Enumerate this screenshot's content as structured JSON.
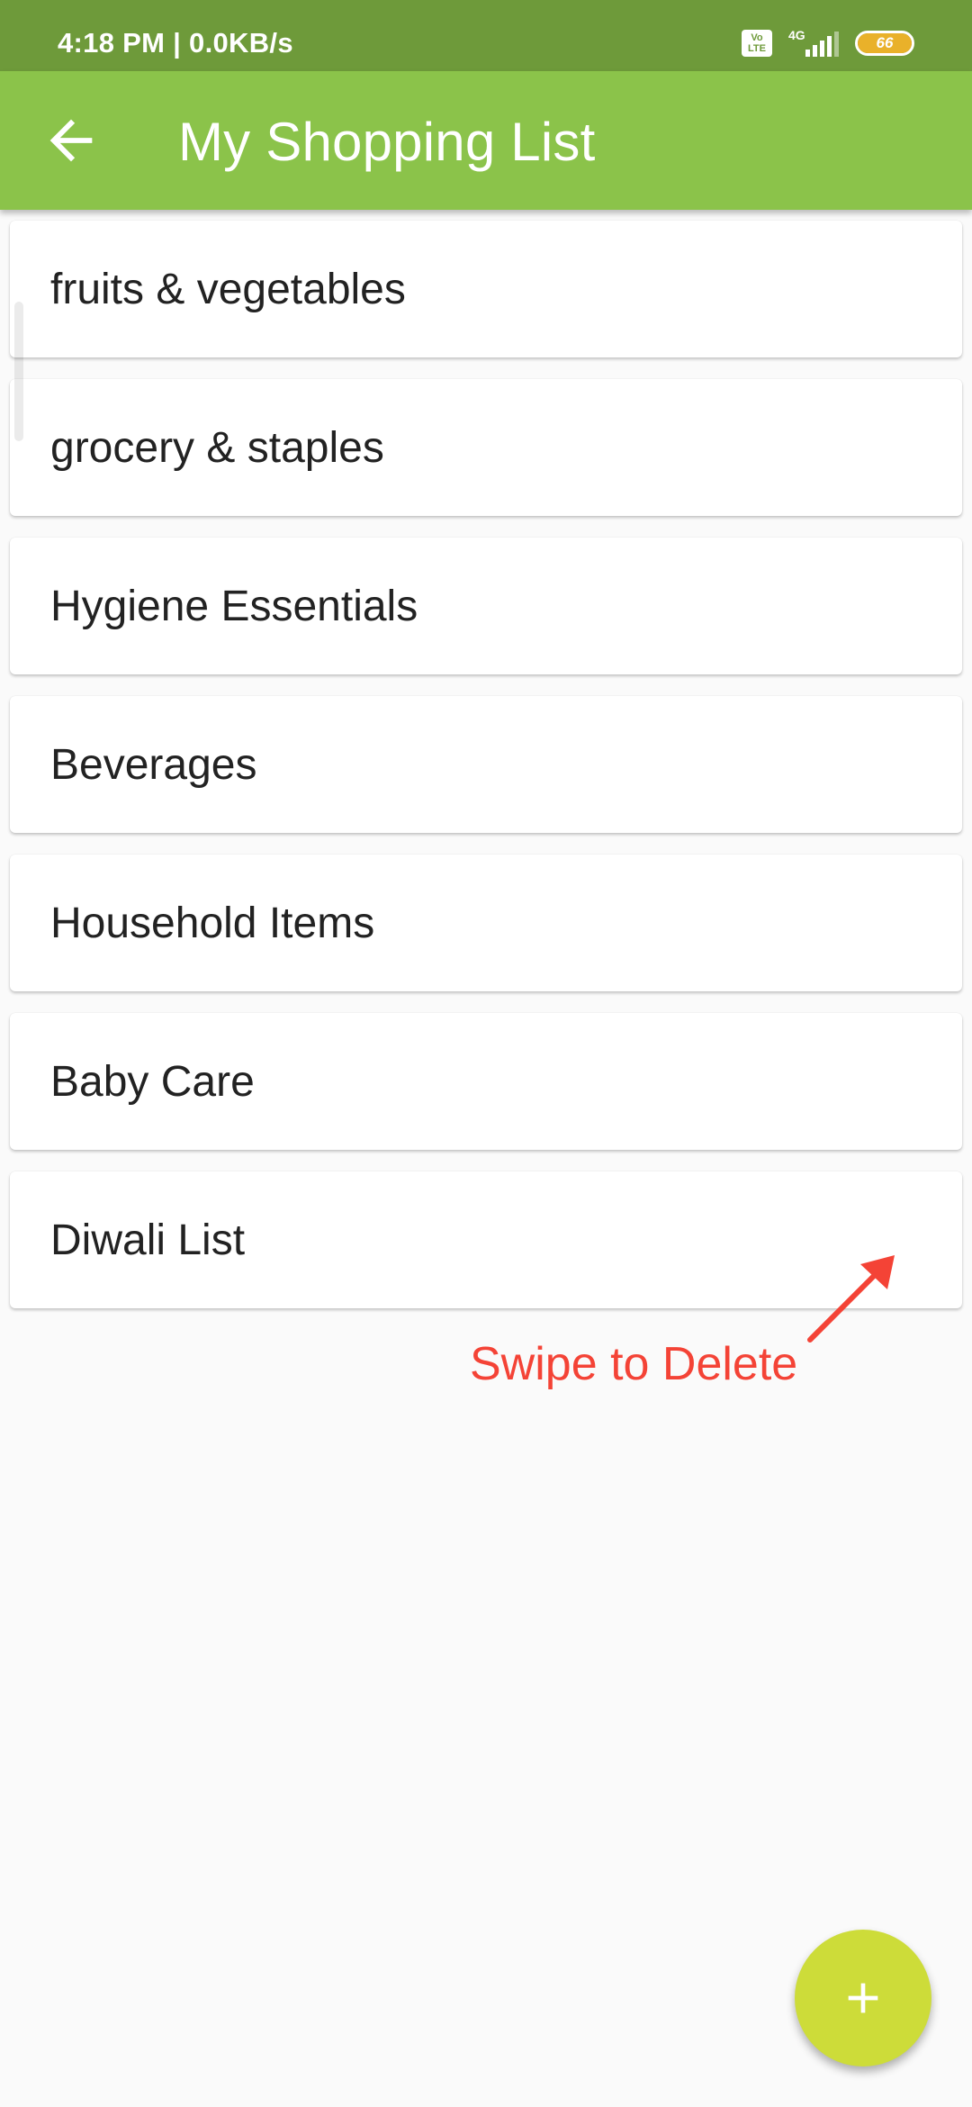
{
  "status_bar": {
    "time_speed": "4:18 PM | 0.0KB/s",
    "volte_line1": "Vo",
    "volte_line2": "LTE",
    "network": "4G",
    "battery": "66"
  },
  "app_bar": {
    "title": "My Shopping List",
    "back_icon": "arrow-left-icon",
    "color": "#8bc34a"
  },
  "list": {
    "items": [
      {
        "label": "fruits & vegetables"
      },
      {
        "label": "grocery & staples"
      },
      {
        "label": "Hygiene Essentials"
      },
      {
        "label": "Beverages"
      },
      {
        "label": "Household Items"
      },
      {
        "label": "Baby Care"
      },
      {
        "label": "Diwali List"
      }
    ]
  },
  "annotation": {
    "text": "Swipe to Delete",
    "color": "#f44336"
  },
  "fab": {
    "icon": "plus-icon",
    "color": "#cddc39"
  },
  "colors": {
    "status_bar": "#6e9a3a",
    "background": "#fafafa"
  }
}
